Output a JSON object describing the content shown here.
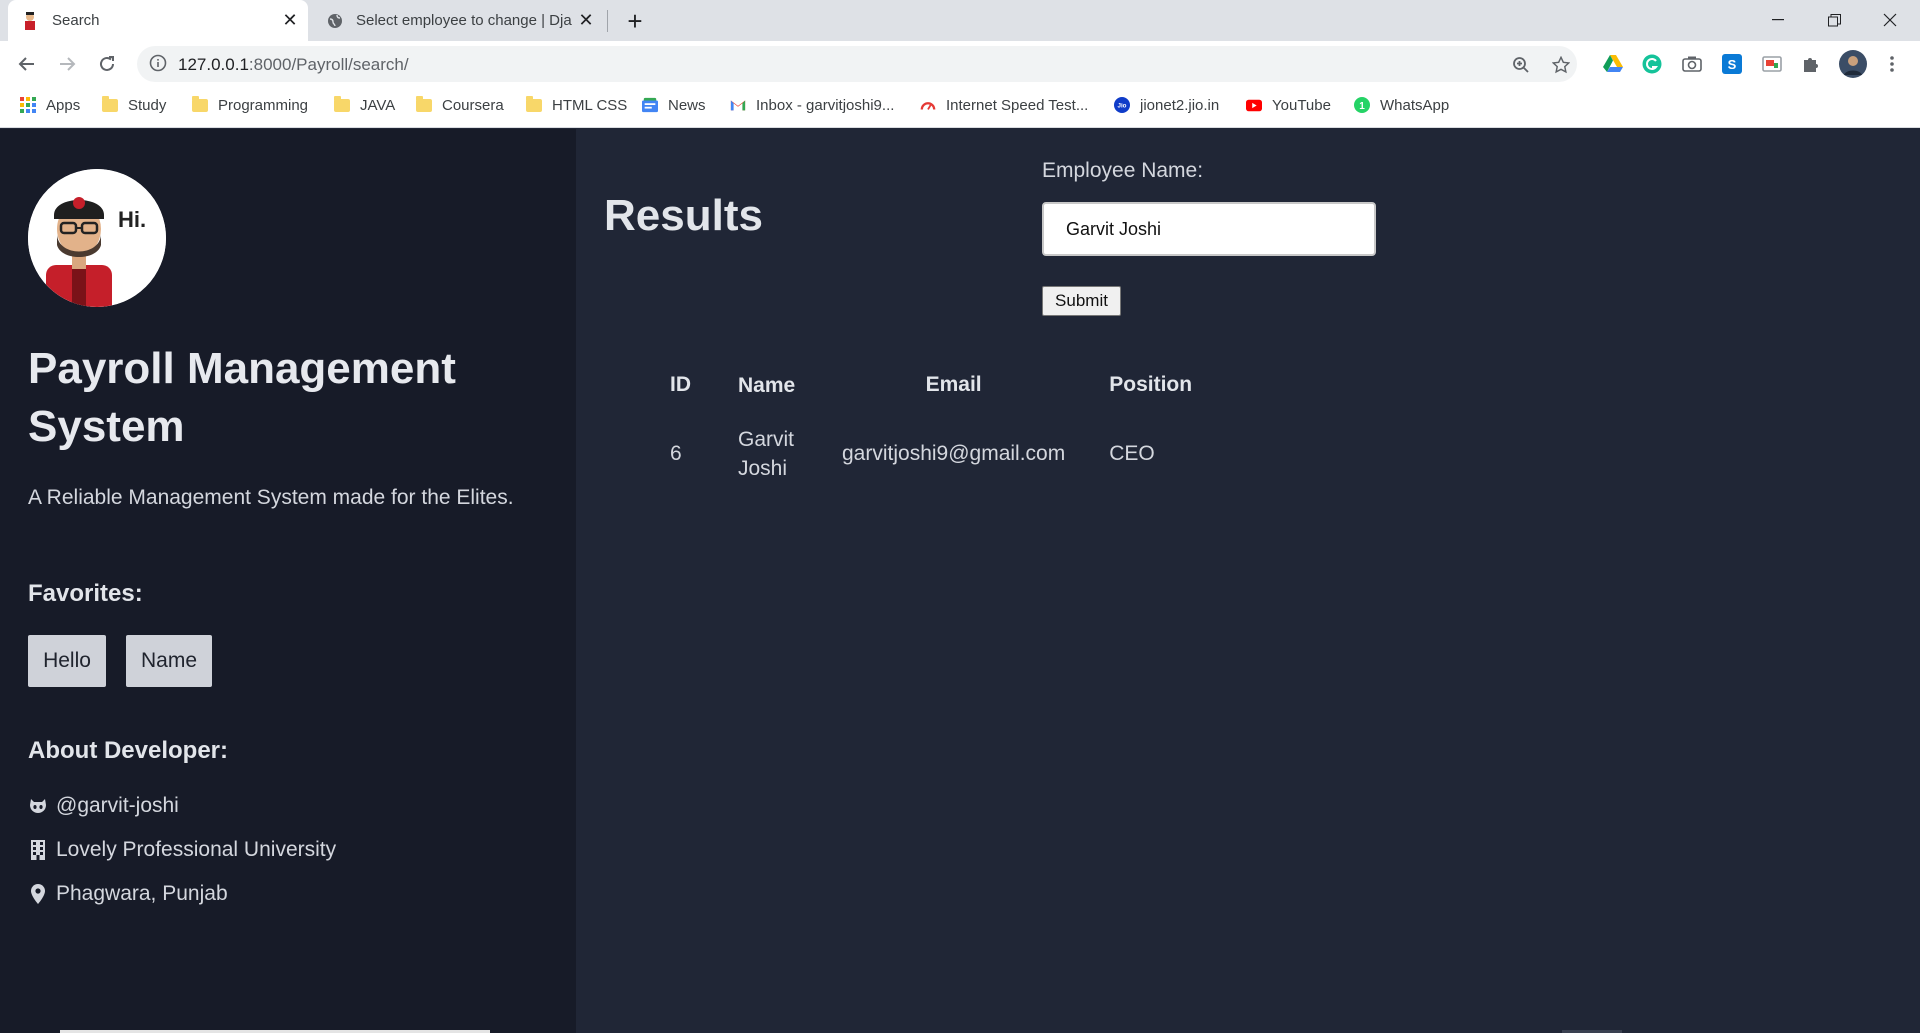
{
  "browser": {
    "tabs": [
      {
        "title": "Search",
        "active": true
      },
      {
        "title": "Select employee to change | Django",
        "active": false
      }
    ],
    "url": {
      "host": "127.0.0.1",
      "path": ":8000/Payroll/search/"
    },
    "bookmarks": [
      {
        "label": "Apps",
        "icon": "apps-grid-icon"
      },
      {
        "label": "Study",
        "icon": "folder-icon"
      },
      {
        "label": "Programming",
        "icon": "folder-icon"
      },
      {
        "label": "JAVA",
        "icon": "folder-icon"
      },
      {
        "label": "Coursera",
        "icon": "folder-icon"
      },
      {
        "label": "HTML CSS",
        "icon": "folder-icon"
      },
      {
        "label": "News",
        "icon": "google-news-icon"
      },
      {
        "label": "Inbox - garvitjoshi9...",
        "icon": "gmail-icon"
      },
      {
        "label": "Internet Speed Test...",
        "icon": "speedometer-icon"
      },
      {
        "label": "jionet2.jio.in",
        "icon": "jio-icon"
      },
      {
        "label": "YouTube",
        "icon": "youtube-icon"
      },
      {
        "label": "WhatsApp",
        "icon": "whatsapp-icon"
      }
    ]
  },
  "sidebar": {
    "avatar_text": "Hi.",
    "title": "Payroll Management System",
    "tagline": "A Reliable Management System made for the Elites.",
    "favorites_heading": "Favorites:",
    "favorites": [
      "Hello",
      "Name"
    ],
    "about_heading": "About Developer:",
    "about": [
      {
        "icon": "github-icon",
        "text": "@garvit-joshi"
      },
      {
        "icon": "building-icon",
        "text": "Lovely Professional University"
      },
      {
        "icon": "map-marker-icon",
        "text": "Phagwara, Punjab"
      }
    ]
  },
  "main": {
    "heading": "Results",
    "form": {
      "label": "Employee Name:",
      "value": "Garvit Joshi",
      "submit_label": "Submit"
    },
    "table": {
      "headers": {
        "id": "ID",
        "name": "Name",
        "email": "Email",
        "position": "Position"
      },
      "rows": [
        {
          "id": "6",
          "name_first": "Garvit",
          "name_last": "Joshi",
          "email": "garvitjoshi9@gmail.com",
          "position": "CEO"
        }
      ]
    }
  },
  "colors": {
    "sidebar_bg": "#171b28",
    "main_bg": "#202636",
    "heading_text": "#e2e5ea",
    "tag_button_bg": "#cfd2d9"
  }
}
